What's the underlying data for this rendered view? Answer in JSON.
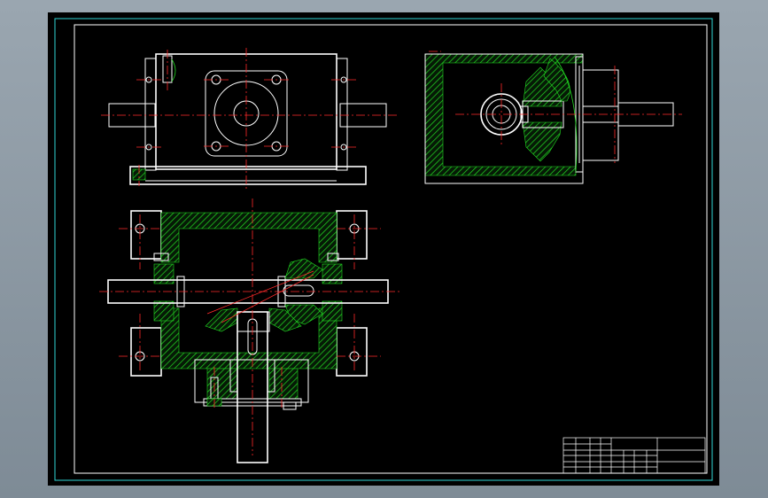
{
  "drawing": {
    "views": [
      "top-view",
      "side-view",
      "section-view"
    ],
    "colors": {
      "background": "#000000",
      "outline": "#ffffff",
      "centerline": "#ff2a2a",
      "hatch": "#22dd22",
      "frame": "#2fd6d6",
      "viewport": "#8d99a4"
    }
  },
  "title_block": {
    "cells": []
  }
}
